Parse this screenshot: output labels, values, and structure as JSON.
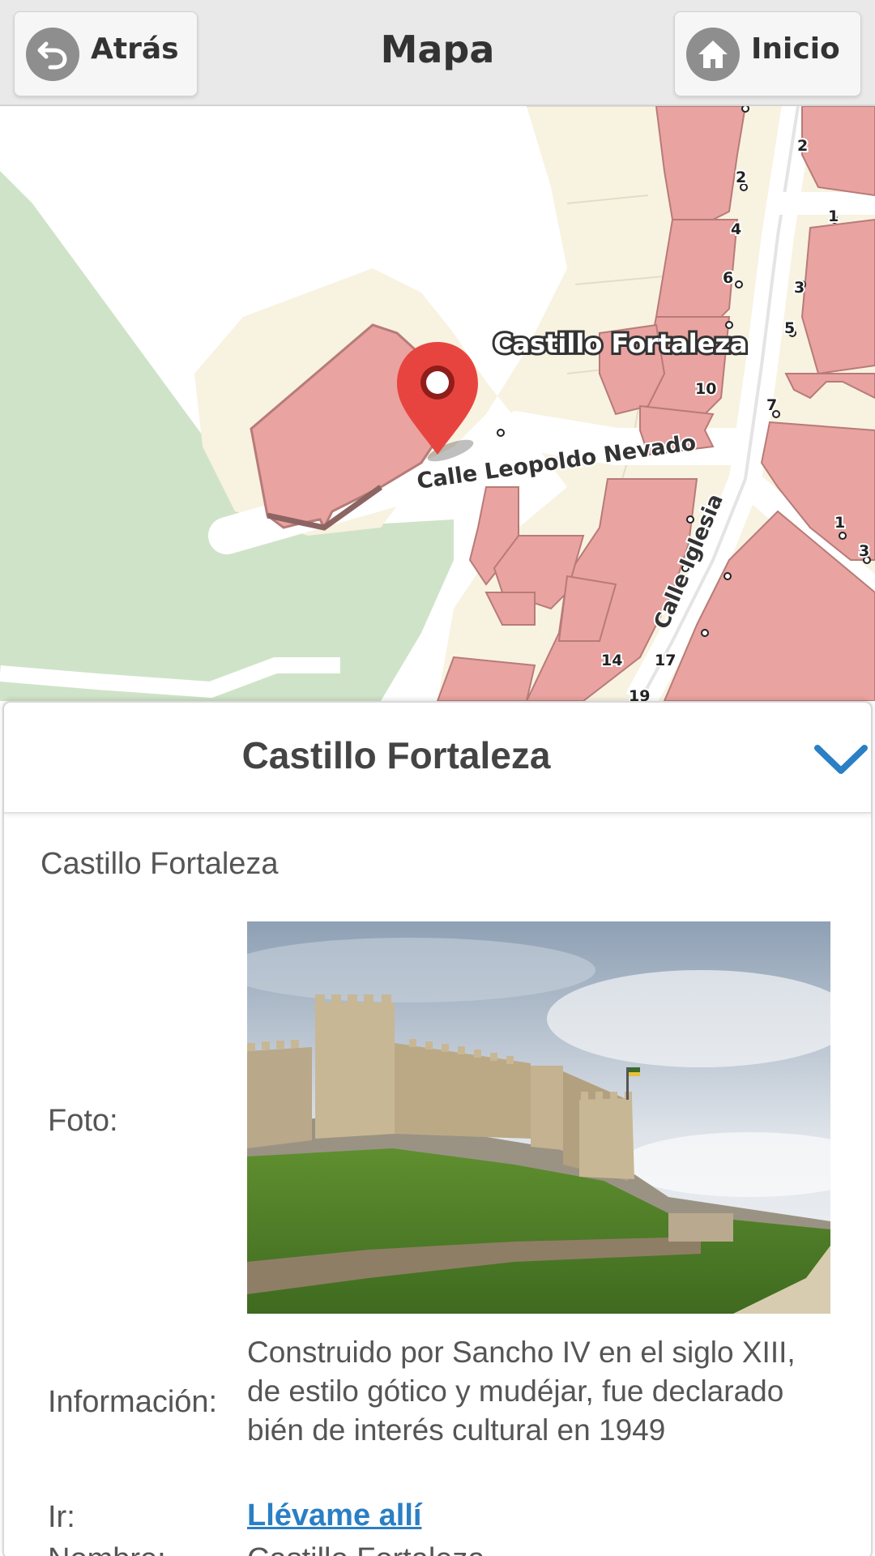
{
  "header": {
    "back_label": "Atrás",
    "title": "Mapa",
    "home_label": "Inicio"
  },
  "map": {
    "place_label": "Castillo Fortaleza",
    "street_1": "Calle Leopoldo Nevado",
    "street_2": "Calle Iglesia",
    "house_numbers": [
      "2",
      "2",
      "4",
      "6",
      "10",
      "1",
      "3",
      "5",
      "7",
      "1",
      "3",
      "14",
      "17",
      "19"
    ],
    "colors": {
      "park": "#cfe3c8",
      "land": "#f8f2e1",
      "building": "#e9a3a0",
      "road": "#ffffff",
      "marker": "#e8443f"
    }
  },
  "panel": {
    "title": "Castillo Fortaleza",
    "subtitle": "Castillo Fortaleza",
    "photo_label": "Foto:",
    "info_label": "Información:",
    "info_text": "Construido por Sancho IV en el siglo XIII, de estilo gótico y mudéjar, fue declarado bién de interés cultural en 1949",
    "go_label": "Ir:",
    "go_link": "Llévame allí",
    "cut_label": "Nombre:",
    "cut_value": "Castillo Fortaleza",
    "accent": "#2a7fc5"
  }
}
